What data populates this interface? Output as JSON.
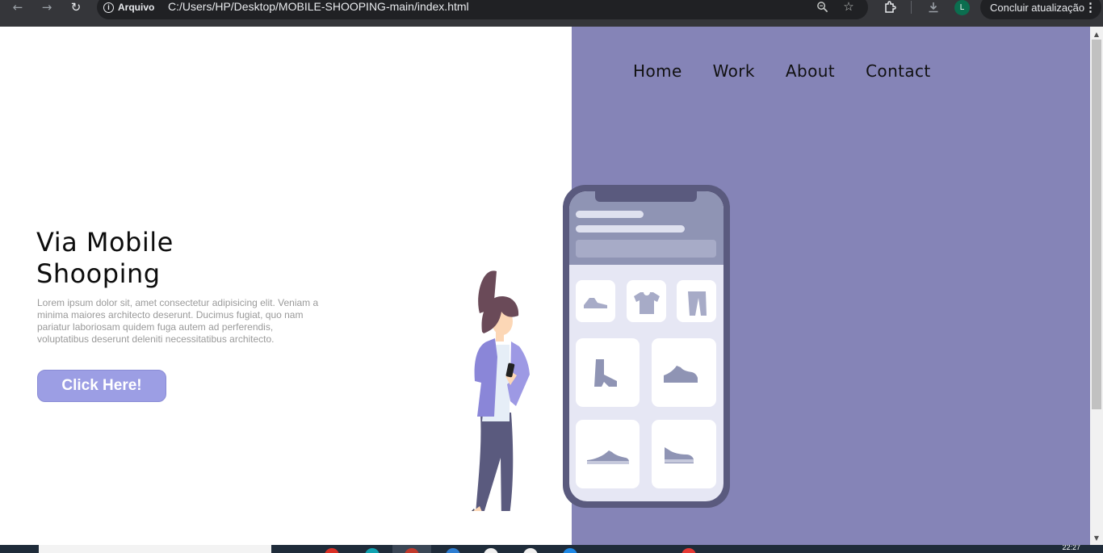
{
  "browser": {
    "site_chip_label": "Arquivo",
    "url": "C:/Users/HP/Desktop/MOBILE-SHOOPING-main/index.html",
    "profile_initial": "L",
    "update_label": "Concluir atualização"
  },
  "nav": {
    "items": [
      "Home",
      "Work",
      "About",
      "Contact"
    ]
  },
  "hero": {
    "title_line1": "Via Mobile",
    "title_line2": "Shooping",
    "description": "Lorem ipsum dolor sit, amet consectetur adipisicing elit. Veniam a minima maiores architecto deserunt. Ducimus fugiat, quo nam pariatur laboriosam quidem fuga autem ad perferendis, voluptatibus deserunt deleniti necessitatibus architecto.",
    "button_label": "Click Here!"
  },
  "taskbar": {
    "clock": "22:27"
  },
  "colors": {
    "panel": "#8584b7",
    "button": "#9c9ee4",
    "phone_frame": "#5a5a7e"
  }
}
